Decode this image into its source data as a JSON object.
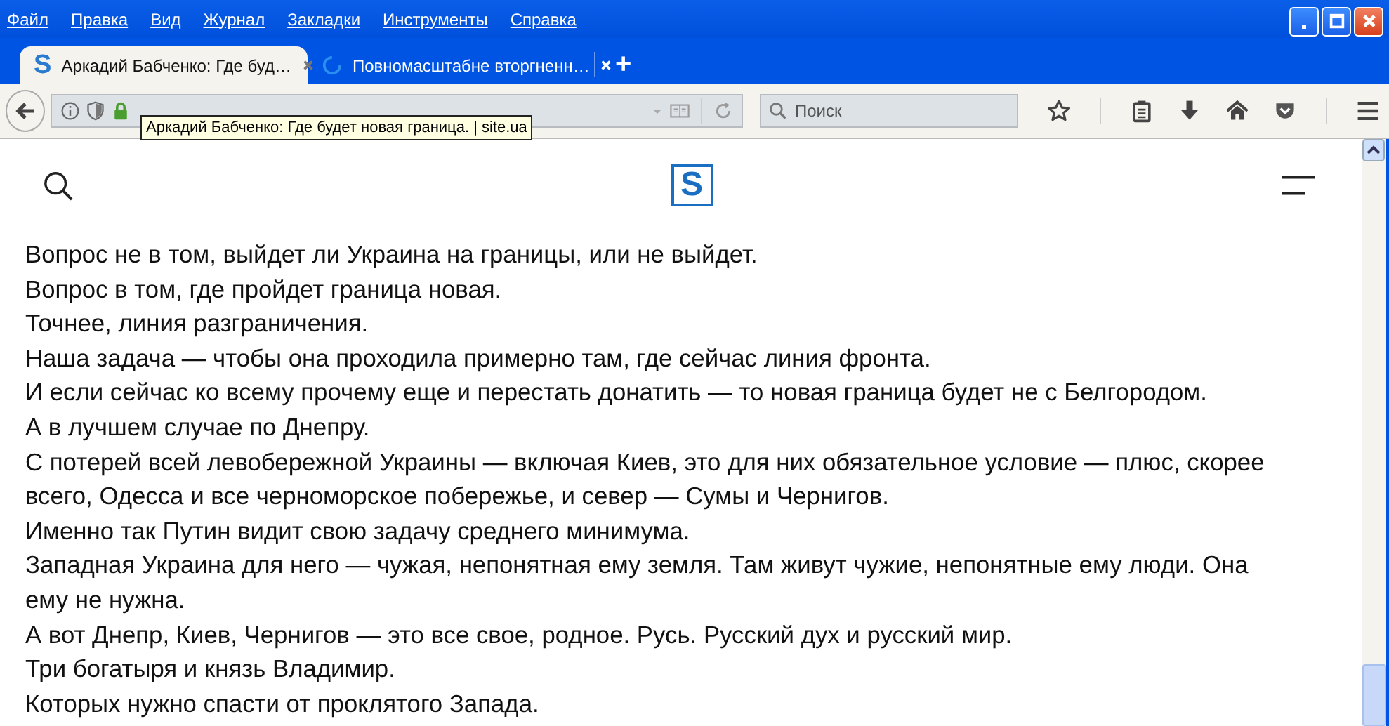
{
  "menu": [
    "Файл",
    "Правка",
    "Вид",
    "Журнал",
    "Закладки",
    "Инструменты",
    "Справка"
  ],
  "tabs": [
    {
      "label": "Аркадий Бабченко: Где буд…",
      "favicon": "S",
      "loading": false,
      "selected": true
    },
    {
      "label": "Повномасштабне вторгненн…",
      "loading": true,
      "selected": false
    }
  ],
  "new_tab": "+",
  "search": {
    "placeholder": "Поиск"
  },
  "tooltip": "Аркадий Бабченко: Где будет новая граница. | site.ua",
  "site_logo": "S",
  "paragraphs": [
    "Вопрос не в том, выйдет ли Украина на границы, или не выйдет.",
    "Вопрос в том, где пройдет граница новая.",
    "Точнее, линия разграничения.",
    "Наша задача — чтобы она проходила примерно там, где сейчас линия фронта.",
    "И если сейчас ко всему прочему еще и перестать донатить — то новая граница будет не с Белгородом.",
    "А в лучшем случае по Днепру.",
    "С потерей всей левобережной Украины — включая Киев, это для них обязательное условие — плюс, скорее всего, Одесса и все черноморское побережье, и север — Сумы и Чернигов.",
    "Именно так Путин видит свою задачу среднего минимума.",
    "Западная Украина для него — чужая, непонятная ему земля. Там живут чужие, непонятные ему люди. Она ему не нужна.",
    "А вот Днепр, Киев, Чернигов — это все свое, родное. Русь. Русский дух и русский мир.",
    "Три богатыря и князь Владимир.",
    "Которых нужно спасти от проклятого Запада."
  ]
}
